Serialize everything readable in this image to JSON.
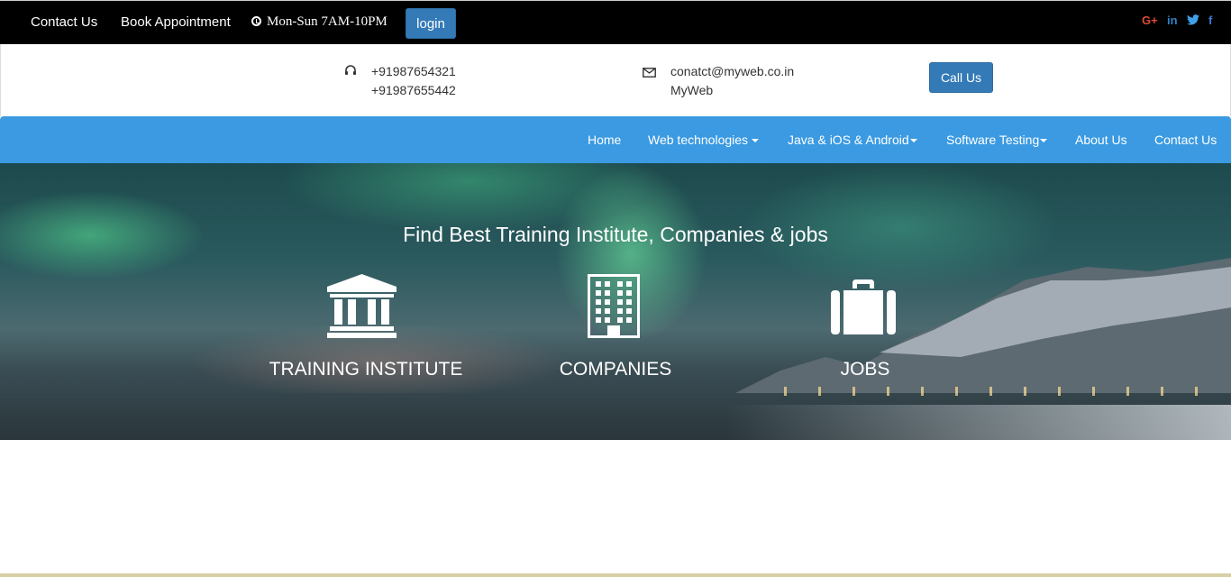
{
  "topbar": {
    "contact_label": "Contact Us",
    "appointment_label": "Book Appointment",
    "hours": "Mon-Sun 7AM-10PM",
    "login_label": "login",
    "social": {
      "google_plus": "G+",
      "linkedin": "in",
      "twitter_icon": "twitter-icon",
      "facebook": "f",
      "colors": {
        "google_plus": "#dd4b39",
        "linkedin": "#2f82c4",
        "twitter": "#3ea1ec",
        "facebook": "#3b7bd0"
      }
    }
  },
  "contact": {
    "phone_icon": "headset-icon",
    "phone1": "+91987654321",
    "phone2": "+91987655442",
    "email_icon": "envelope-icon",
    "email": "conatct@myweb.co.in",
    "site": "MyWeb",
    "call_label": "Call Us"
  },
  "nav": {
    "items": [
      {
        "label": "Home"
      },
      {
        "label": "Web technologies"
      },
      {
        "label": "Java & iOS & Android"
      },
      {
        "label": "Software Testing"
      },
      {
        "label": "About Us"
      },
      {
        "label": "Contact Us"
      }
    ],
    "color": "#3b9ae1"
  },
  "hero": {
    "title": "Find Best Training Institute, Companies & jobs",
    "categories": [
      {
        "label": "TRAINING INSTITUTE",
        "icon": "institution-icon"
      },
      {
        "label": "COMPANIES",
        "icon": "building-icon"
      },
      {
        "label": "JOBS",
        "icon": "briefcase-icon"
      }
    ]
  },
  "colors": {
    "accent": "#337ab7",
    "topbar_bg": "#000000"
  }
}
